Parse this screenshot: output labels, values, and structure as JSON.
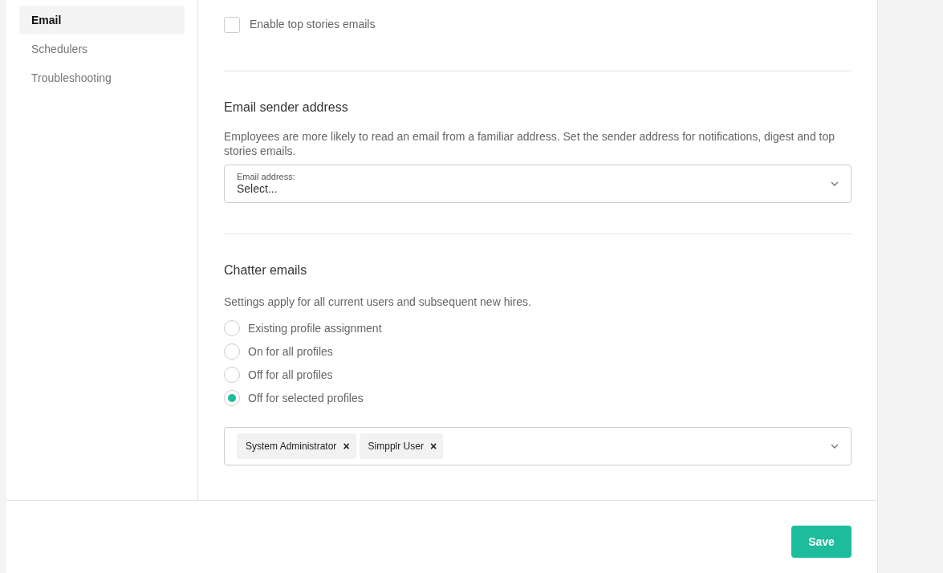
{
  "sidebar": {
    "items": [
      {
        "label": "Email",
        "selected": true
      },
      {
        "label": "Schedulers",
        "selected": false
      },
      {
        "label": "Troubleshooting",
        "selected": false
      }
    ]
  },
  "top_stories": {
    "checkbox": {
      "label": "Enable top stories emails",
      "checked": false
    }
  },
  "sender": {
    "title": "Email sender address",
    "description": "Employees are more likely to read an email from a familiar address. Set the sender address for notifications, digest and top stories emails.",
    "select": {
      "label": "Email address:",
      "placeholder": "Select..."
    }
  },
  "chatter": {
    "title": "Chatter emails",
    "description": "Settings apply for all current users and subsequent new hires.",
    "options": [
      {
        "label": "Existing profile assignment",
        "selected": false
      },
      {
        "label": "On for all profiles",
        "selected": false
      },
      {
        "label": "Off for all profiles",
        "selected": false
      },
      {
        "label": "Off for selected profiles",
        "selected": true
      }
    ],
    "profiles": [
      {
        "label": "System Administrator",
        "remove": "×"
      },
      {
        "label": "Simpplr User",
        "remove": "×"
      }
    ]
  },
  "footer": {
    "save": "Save"
  }
}
